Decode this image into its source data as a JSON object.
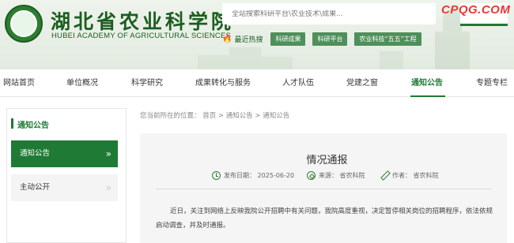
{
  "header": {
    "logo_cn": "湖北省农业科学院",
    "logo_en": "HUBEI ACADEMY OF AGRICULTURAL SCIENCES",
    "search_placeholder": "全站搜索科研平台\\农业技术\\成果...",
    "watermark": "CPQG.COM",
    "hot_label": "最近热搜",
    "hot_tags": [
      "科研成果",
      "科研平台",
      "农业科技“五五”工程"
    ]
  },
  "nav": {
    "items": [
      "网站首页",
      "单位概况",
      "科学研究",
      "成果转化与服务",
      "人才队伍",
      "党建之窗",
      "通知公告",
      "专题专栏"
    ],
    "active": "通知公告"
  },
  "sidebar": {
    "title": "通知公告",
    "items": [
      {
        "label": "通知公告",
        "arrow": "»",
        "active": true
      },
      {
        "label": "主动公开",
        "arrow": "»",
        "active": false
      }
    ]
  },
  "breadcrumb": "您当前所在的位置：  首页 > 通知公告 > 通知公告",
  "article": {
    "title": "情况通报",
    "date": "发布日期：  2025-06-20",
    "source": "来源：  省农科院",
    "author": "作者：  省农科院",
    "body": "近日，关注到网络上反映我院公开招聘中有关问题，我院高度重视，决定暂停相关岗位的招聘程序，依法依规启动调查，并及时通报。"
  },
  "colors": {
    "primary_green": "#1e7a35",
    "watermark_red": "#e53935"
  }
}
